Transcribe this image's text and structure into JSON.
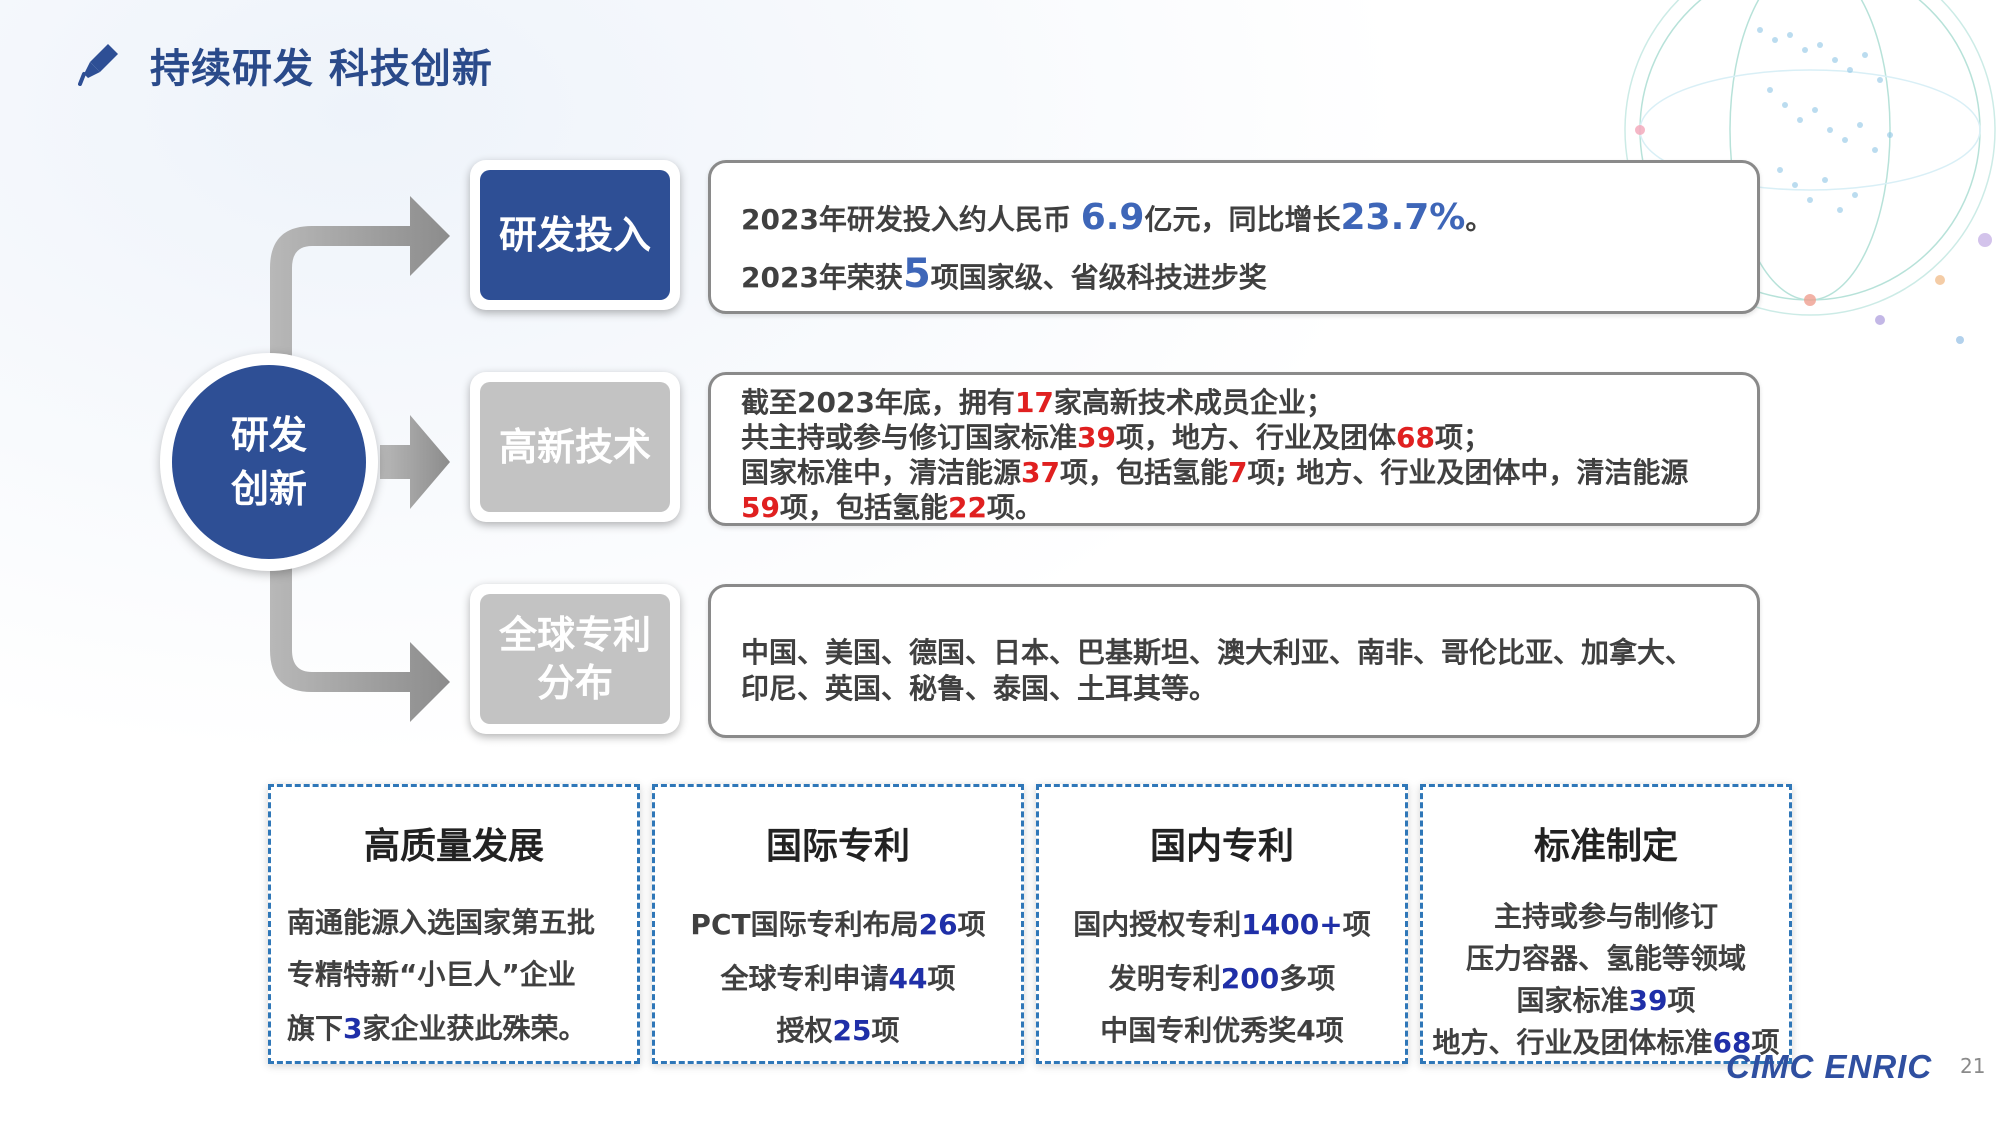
{
  "header": {
    "title": "持续研发 科技创新",
    "icon": "pen-nib-icon"
  },
  "hub": {
    "line1": "研发",
    "line2": "创新"
  },
  "rows": {
    "r1": {
      "tag": "研发投入",
      "p1_a": "2023年研发投入约人民币 ",
      "p1_b": "6.9",
      "p1_c": "亿元，同比增长",
      "p1_d": "23.7%",
      "p1_e": "。",
      "p2_a": "2023年荣获",
      "p2_b": "5",
      "p2_c": "项国家级、省级科技进步奖"
    },
    "r2": {
      "tag": "高新技术",
      "l1_a": "截至2023年底，拥有",
      "l1_b": "17",
      "l1_c": "家高新技术成员企业；",
      "l2_a": "共主持或参与修订国家标准",
      "l2_b": "39",
      "l2_c": "项，地方、行业及团体",
      "l2_d": "68",
      "l2_e": "项；",
      "l3_a": "国家标准中，清洁能源",
      "l3_b": "37",
      "l3_c": "项，包括氢能",
      "l3_d": "7",
      "l3_e": "项; 地方、行业及团体中，清洁能源",
      "l4_a": "59",
      "l4_b": "项，包括氢能",
      "l4_c": "22",
      "l4_d": "项。"
    },
    "r3": {
      "tag_line1": "全球专利",
      "tag_line2": "分布",
      "l1": "中国、美国、德国、日本、巴基斯坦、澳大利亚、南非、哥伦比亚、加拿大、",
      "l2": "印尼、英国、秘鲁、泰国、土耳其等。"
    }
  },
  "cards": {
    "c1": {
      "title": "高质量发展",
      "l1": "南通能源入选国家第五批",
      "l2": "专精特新“小巨人”企业",
      "l3_a": "旗下",
      "l3_b": "3",
      "l3_c": "家企业获此殊荣。"
    },
    "c2": {
      "title": "国际专利",
      "l1_a": "PCT国际专利布局",
      "l1_b": "26",
      "l1_c": "项",
      "l2_a": "全球专利申请",
      "l2_b": "44",
      "l2_c": "项",
      "l3_a": "授权",
      "l3_b": "25",
      "l3_c": "项"
    },
    "c3": {
      "title": "国内专利",
      "l1_a": "国内授权专利",
      "l1_b": "1400+",
      "l1_c": "项",
      "l2_a": "发明专利",
      "l2_b": "200",
      "l2_c": "多项",
      "l3": "中国专利优秀奖4项"
    },
    "c4": {
      "title": "标准制定",
      "l1": "主持或参与制修订",
      "l2": "压力容器、氢能等领域",
      "l3_a": "国家标准",
      "l3_b": "39",
      "l3_c": "项",
      "l4_a": "地方、行业及团体标准",
      "l4_b": "68",
      "l4_c": "项"
    }
  },
  "footer": {
    "logo": "CIMC ENRIC",
    "page": "21"
  },
  "colors": {
    "primary": "#2e4f95",
    "grey_tag": "#c3c3c3",
    "highlight_blue": "#3e66b8",
    "highlight_red": "#e02020",
    "highlight_navy": "#1f2fa8",
    "highlight_orange": "#ee7a20",
    "card_border": "#2f77b8"
  }
}
